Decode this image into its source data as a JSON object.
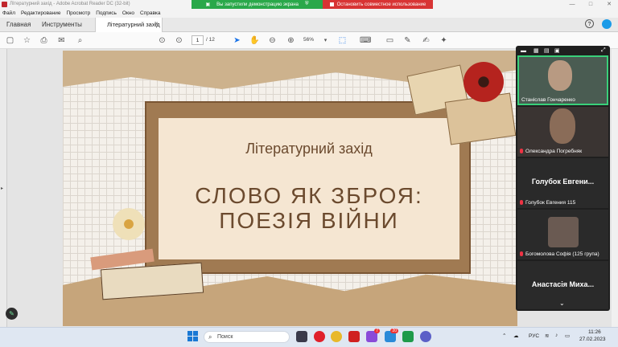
{
  "window": {
    "title": "Літературний захід - Adobe Acrobat Reader DC (32-bit)",
    "controls": [
      "—",
      "□",
      "✕"
    ]
  },
  "sharing_bar": {
    "status": "Вы запустили демонстрацию экрана",
    "stop_label": "Остановить совместное использование",
    "accent_green": "#2aa84a",
    "accent_red": "#d83434"
  },
  "menu": [
    "Файл",
    "Редактирование",
    "Просмотр",
    "Подпись",
    "Окно",
    "Справка"
  ],
  "tabs": {
    "home": "Главная",
    "tools": "Инструменты",
    "document": "Літературний захід",
    "close": "✕"
  },
  "toolbar": {
    "page_current": "1",
    "page_total": "/ 12",
    "zoom": "56%"
  },
  "slide": {
    "subtitle": "Літературний захід",
    "title_line1": "СЛОВО ЯК ЗБРОЯ:",
    "title_line2": "ПОЕЗІЯ ВІЙНИ",
    "text_color": "#6b4a2e"
  },
  "participants": {
    "p1": "Станіслав Гончаренко",
    "p2": "Олександра Погребняк",
    "p3_big": "Голубок Евгени...",
    "p3": "Голубок Евгения 115",
    "p4": "Богомолова Софія (125 група)",
    "p5_big": "Анастасія Миха..."
  },
  "taskbar": {
    "search_label": "Поиск",
    "lang": "РУС",
    "time": "11:26",
    "date": "27.02.2023",
    "badge_1": "7",
    "badge_2": "20"
  }
}
